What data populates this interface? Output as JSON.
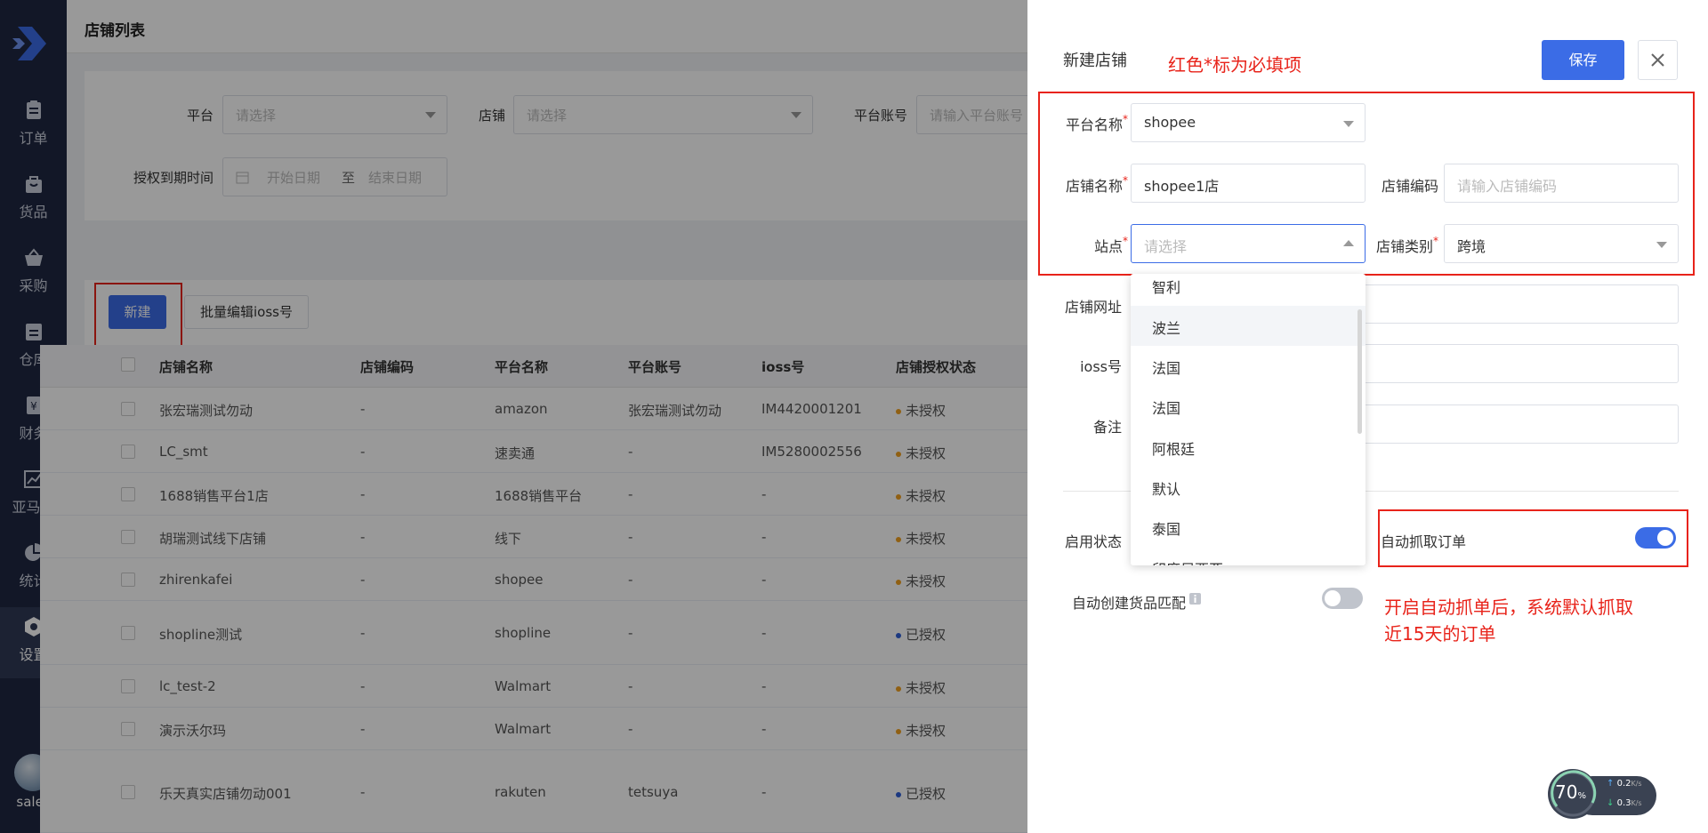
{
  "sidebar": {
    "items": [
      {
        "label": "订单",
        "icon": "clipboard-icon"
      },
      {
        "label": "货品",
        "icon": "bag-icon"
      },
      {
        "label": "采购",
        "icon": "basket-icon"
      },
      {
        "label": "仓库",
        "icon": "warehouse-icon"
      },
      {
        "label": "财务",
        "icon": "yen-icon"
      },
      {
        "label": "亚马逊",
        "icon": "trend-chart-icon"
      },
      {
        "label": "统计",
        "icon": "pie-chart-icon"
      },
      {
        "label": "设置",
        "icon": "settings-icon"
      }
    ],
    "active": "设置",
    "user": "sales"
  },
  "page": {
    "title": "店铺列表"
  },
  "filters": {
    "platform_label": "平台",
    "platform_placeholder": "请选择",
    "shop_label": "店铺",
    "shop_placeholder": "请选择",
    "account_label": "平台账号",
    "account_placeholder": "请输入平台账号",
    "expire_label": "授权到期时间",
    "start_placeholder": "开始日期",
    "range_sep": "至",
    "end_placeholder": "结束日期"
  },
  "toolbar": {
    "new_label": "新建",
    "batch_label": "批量编辑ioss号"
  },
  "table": {
    "headers": [
      "店铺名称",
      "店铺编码",
      "平台名称",
      "平台账号",
      "ioss号",
      "店铺授权状态"
    ],
    "rows": [
      {
        "name": "张宏瑞测试勿动",
        "code": "-",
        "platform": "amazon",
        "account": "张宏瑞测试勿动",
        "ioss": "IM4420001201",
        "status": "未授权"
      },
      {
        "name": "LC_smt",
        "code": "-",
        "platform": "速卖通",
        "account": "-",
        "ioss": "IM5280002556",
        "status": "未授权"
      },
      {
        "name": "1688销售平台1店",
        "code": "-",
        "platform": "1688销售平台",
        "account": "-",
        "ioss": "-",
        "status": "未授权"
      },
      {
        "name": "胡瑞测试线下店铺",
        "code": "-",
        "platform": "线下",
        "account": "-",
        "ioss": "-",
        "status": "未授权"
      },
      {
        "name": "zhirenkafei",
        "code": "-",
        "platform": "shopee",
        "account": "-",
        "ioss": "-",
        "status": "未授权"
      },
      {
        "name": "shopline测试",
        "code": "-",
        "platform": "shopline",
        "account": "-",
        "ioss": "-",
        "status": "已授权"
      },
      {
        "name": "lc_test-2",
        "code": "-",
        "platform": "Walmart",
        "account": "-",
        "ioss": "-",
        "status": "未授权"
      },
      {
        "name": "演示沃尔玛",
        "code": "-",
        "platform": "Walmart",
        "account": "-",
        "ioss": "-",
        "status": "未授权"
      },
      {
        "name": "乐天真实店铺勿动001",
        "code": "-",
        "platform": "rakuten",
        "account": "tetsuya",
        "ioss": "-",
        "status": "已授权"
      }
    ],
    "status_colors": {
      "未授权": "#f0a020",
      "已授权": "#2f5fd8"
    }
  },
  "drawer": {
    "title": "新建店铺",
    "save_label": "保存",
    "close_icon": "close-icon",
    "platform_name_label": "平台名称",
    "platform_name_value": "shopee",
    "shop_name_label": "店铺名称",
    "shop_name_value": "shopee1店",
    "shop_code_label": "店铺编码",
    "shop_code_placeholder": "请输入店铺编码",
    "site_label": "站点",
    "site_placeholder": "请选择",
    "shop_type_label": "店铺类别",
    "shop_type_value": "跨境",
    "shop_url_label": "店铺网址",
    "ioss_label": "ioss号",
    "remark_label": "备注",
    "enable_label": "启用状态",
    "auto_fetch_label": "自动抓取订单",
    "auto_fetch_on": true,
    "auto_match_label": "自动创建货品匹配",
    "auto_match_on": false,
    "site_options": [
      "智利",
      "波兰",
      "法国",
      "法国",
      "阿根廷",
      "默认",
      "泰国",
      "印度尼西亚"
    ],
    "site_hover": "波兰"
  },
  "annotations": {
    "required_note": "红色*标为必填项",
    "fetch_note_line1": "开启自动抓单后，系统默认抓取",
    "fetch_note_line2": "近15天的订单",
    "color": "#e8231a"
  },
  "speed_widget": {
    "percent": "70",
    "percent_unit": "%",
    "up": "0.2",
    "down": "0.3",
    "unit": "K/s"
  }
}
